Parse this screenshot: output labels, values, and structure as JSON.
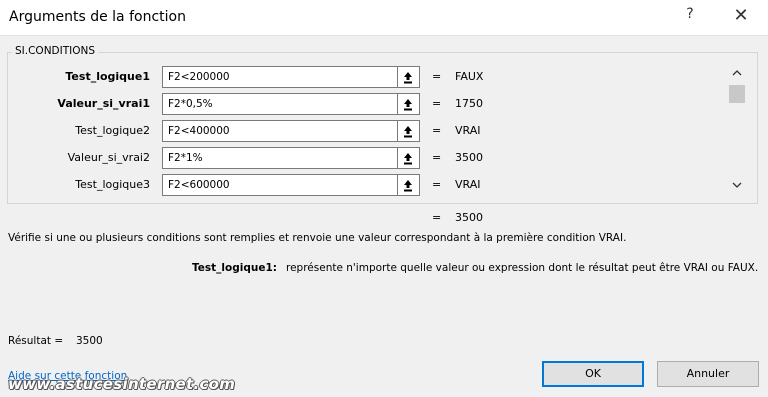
{
  "window": {
    "title": "Arguments de la fonction",
    "help_glyph": "?",
    "close_glyph": "✕"
  },
  "function": {
    "name": "SI.CONDITIONS",
    "args": [
      {
        "label": "Test_logique1",
        "bold": true,
        "value": "F2<200000",
        "result": "FAUX"
      },
      {
        "label": "Valeur_si_vrai1",
        "bold": true,
        "value": "F2*0,5%",
        "result": "1750"
      },
      {
        "label": "Test_logique2",
        "bold": false,
        "value": "F2<400000",
        "result": "VRAI"
      },
      {
        "label": "Valeur_si_vrai2",
        "bold": false,
        "value": "F2*1%",
        "result": "3500"
      },
      {
        "label": "Test_logique3",
        "bold": false,
        "value": "F2<600000",
        "result": "VRAI"
      }
    ],
    "equals": "=",
    "overall_result": "3500",
    "description": "Vérifie si une ou plusieurs conditions sont remplies et renvoie une valeur correspondant à la première condition VRAI.",
    "arg_help": {
      "name": "Test_logique1:",
      "text": "représente n'importe quelle valeur ou expression dont le résultat peut être VRAI ou FAUX."
    }
  },
  "result": {
    "label": "Résultat =",
    "value": "3500"
  },
  "help_link": "Aide sur cette fonction",
  "buttons": {
    "ok": "OK",
    "cancel": "Annuler"
  },
  "watermark": "www.astucesinternet.com",
  "icons": {
    "ref_button": "collapse-reference-icon",
    "scroll_up": "chevron-up-icon",
    "scroll_down": "chevron-down-icon"
  }
}
